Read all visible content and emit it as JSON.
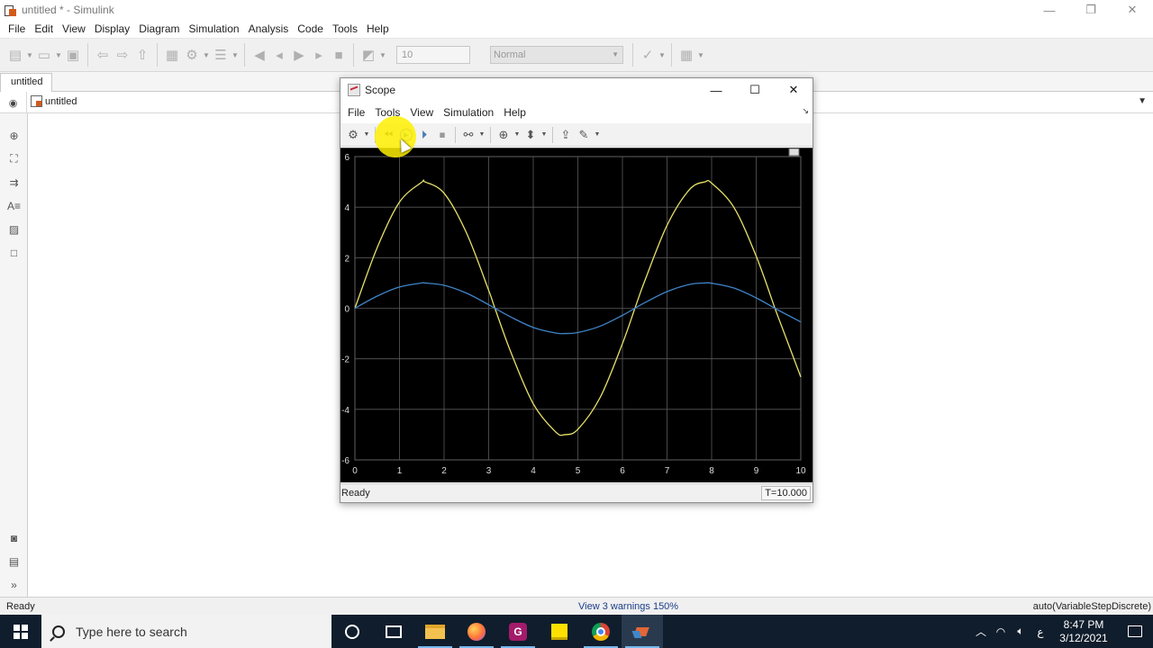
{
  "window": {
    "title": "untitled * - Simulink",
    "minimize": "—",
    "restore": "❐",
    "close": "✕"
  },
  "menu": [
    "File",
    "Edit",
    "View",
    "Display",
    "Diagram",
    "Simulation",
    "Analysis",
    "Code",
    "Tools",
    "Help"
  ],
  "toolbar": {
    "stop_time": "10",
    "sim_mode": "Normal"
  },
  "tabs": {
    "active": "untitled"
  },
  "breadcrumb": {
    "model": "untitled"
  },
  "status": {
    "left": "Ready",
    "middle": "View 3 warnings  150%",
    "right": "auto(VariableStepDiscrete)"
  },
  "taskbar": {
    "search_placeholder": "Type here to search",
    "pdf_label": "G",
    "lang": "ع",
    "time": "8:47 PM",
    "date": "3/12/2021"
  },
  "scope": {
    "title": "Scope",
    "minimize": "—",
    "maximize": "☐",
    "close": "✕",
    "menu": [
      "File",
      "Tools",
      "View",
      "Simulation",
      "Help"
    ],
    "status": "Ready",
    "time_readout": "T=10.000"
  },
  "colors": {
    "series_1": "#e6e26a",
    "series_2": "#3f84c8",
    "plot_bg": "#000000",
    "grid": "#5a5a5a"
  },
  "chart_data": {
    "type": "line",
    "title": "",
    "xlabel": "",
    "ylabel": "",
    "xlim": [
      0,
      10
    ],
    "ylim": [
      -6,
      6
    ],
    "xticks": [
      "0",
      "1",
      "2",
      "3",
      "4",
      "5",
      "6",
      "7",
      "8",
      "9",
      "10"
    ],
    "yticks": [
      "6",
      "4",
      "2",
      "0",
      "-2",
      "-4",
      "-6"
    ],
    "grid": true,
    "series": [
      {
        "color": "#e6e26a",
        "x": [
          0,
          0.5,
          1,
          1.5,
          1.57,
          2,
          2.5,
          3,
          3.14,
          3.5,
          4,
          4.5,
          4.71,
          5,
          5.5,
          6,
          6.28,
          6.5,
          7,
          7.5,
          7.85,
          8,
          8.5,
          9,
          9.42,
          9.5,
          10
        ],
        "y": [
          0,
          2.4,
          4.2,
          4.99,
          5,
          4.55,
          2.99,
          0.71,
          0,
          -1.75,
          -3.78,
          -4.89,
          -5,
          -4.79,
          -3.53,
          -1.4,
          0,
          1.08,
          3.28,
          4.69,
          5,
          4.95,
          3.99,
          2.06,
          0,
          -0.38,
          -2.72
        ]
      },
      {
        "color": "#3f84c8",
        "x": [
          0,
          0.5,
          1,
          1.5,
          1.57,
          2,
          2.5,
          3,
          3.14,
          3.5,
          4,
          4.5,
          4.71,
          5,
          5.5,
          6,
          6.28,
          6.5,
          7,
          7.5,
          7.85,
          8,
          8.5,
          9,
          9.42,
          9.5,
          10
        ],
        "y": [
          0,
          0.48,
          0.84,
          1,
          1,
          0.91,
          0.6,
          0.14,
          0,
          -0.35,
          -0.76,
          -0.98,
          -1,
          -0.96,
          -0.71,
          -0.28,
          0,
          0.22,
          0.66,
          0.94,
          1,
          0.99,
          0.8,
          0.41,
          0,
          -0.08,
          -0.54
        ]
      }
    ]
  }
}
